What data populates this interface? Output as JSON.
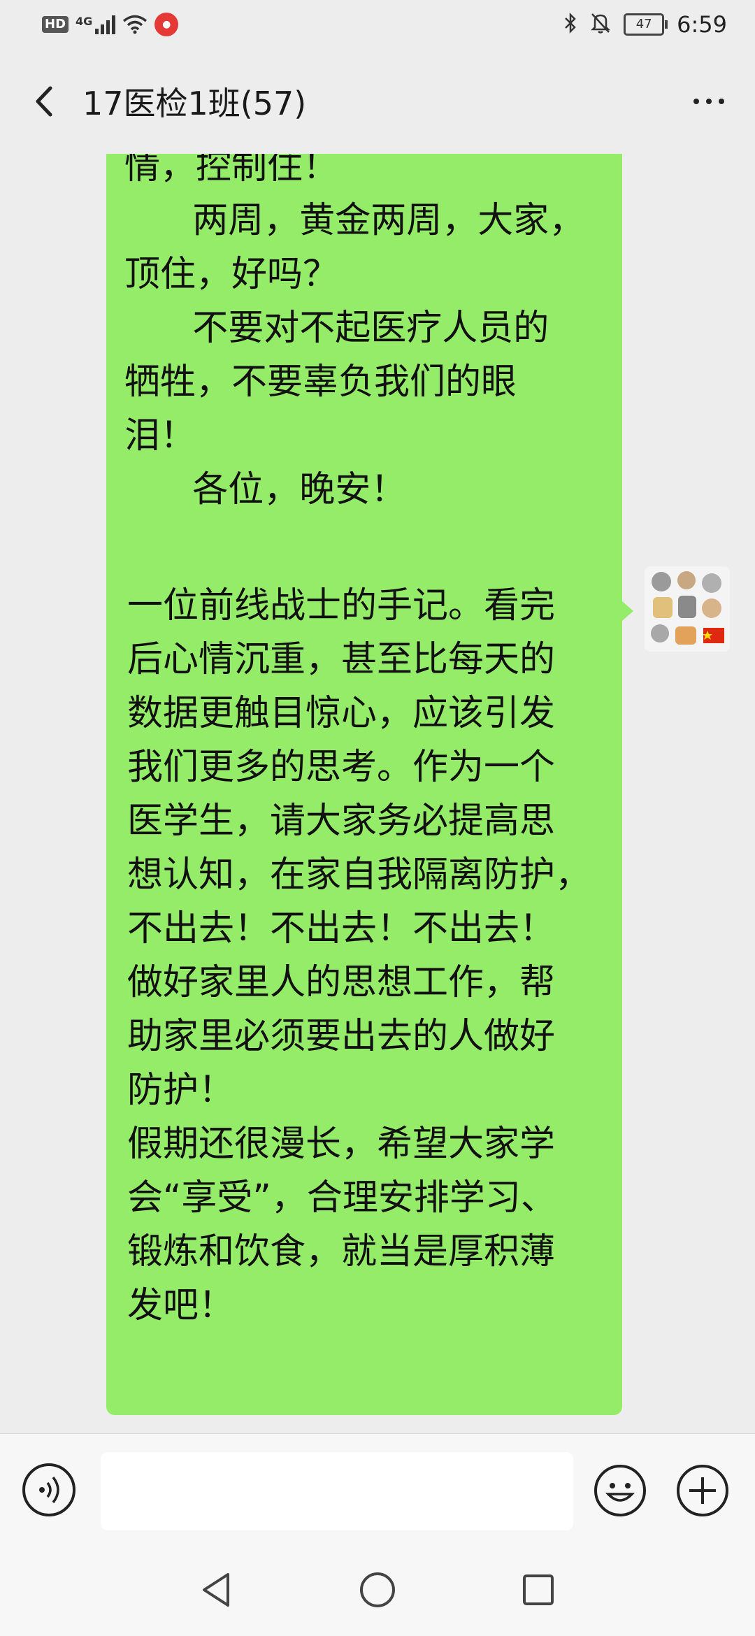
{
  "status_bar": {
    "hd": "HD",
    "network": "4G",
    "battery": "47",
    "time": "6:59"
  },
  "header": {
    "title": "17医检1班(57)"
  },
  "messages": [
    {
      "sender": "self",
      "text": "情，控制住！\n      两周，黄金两周，大家，\n顶住，好吗？\n      不要对不起医疗人员的\n牺牲，不要辜负我们的眼\n泪！\n      各位，晚安！"
    },
    {
      "sender": "self",
      "text": "一位前线战士的手记。看完\n后心情沉重，甚至比每天的\n数据更触目惊心，应该引发\n我们更多的思考。作为一个\n医学生，请大家务必提高思\n想认知，在家自我隔离防护，\n不出去！不出去！不出去！\n做好家里人的思想工作，帮\n助家里必须要出去的人做好\n防护！\n假期还很漫长，希望大家学\n会“享受”，合理安排学习、\n锻炼和饮食，就当是厚积薄\n发吧！"
    }
  ],
  "input": {
    "value": ""
  },
  "icons": {
    "back": "chevron-left-icon",
    "more": "more-dots-icon",
    "voice": "voice-icon",
    "emoji": "smiley-icon",
    "plus": "plus-icon",
    "nav_back": "nav-back-icon",
    "nav_home": "nav-home-icon",
    "nav_recent": "nav-recent-icon"
  },
  "colors": {
    "bubble": "#95ec69",
    "background": "#ededed"
  }
}
